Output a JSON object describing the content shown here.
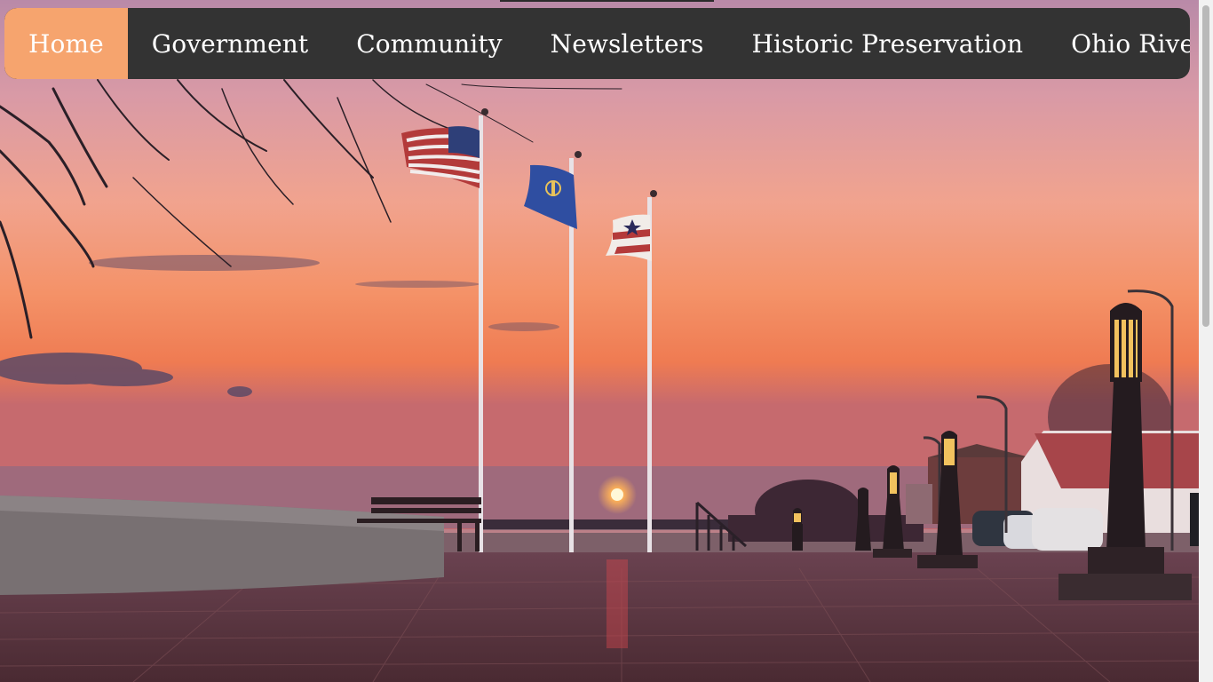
{
  "nav": {
    "items": [
      {
        "label": "Home",
        "active": true
      },
      {
        "label": "Government"
      },
      {
        "label": "Community"
      },
      {
        "label": "Newsletters"
      },
      {
        "label": "Historic Preservation"
      },
      {
        "label": "Ohio River"
      }
    ],
    "active_color": "#f6a46e",
    "bar_color": "#333333"
  },
  "hero": {
    "icons": [
      "us-flag-icon",
      "indiana-flag-icon",
      "city-flag-icon",
      "street-lamp-icon",
      "bench-icon",
      "sun-icon"
    ]
  }
}
